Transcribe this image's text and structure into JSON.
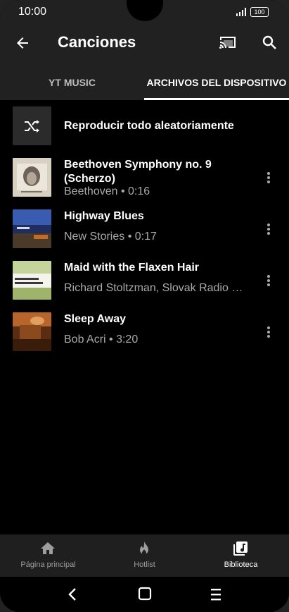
{
  "status_bar": {
    "time": "10:00",
    "battery": "100"
  },
  "app_bar": {
    "title": "Canciones"
  },
  "tabs": [
    {
      "label": "YT MUSIC"
    },
    {
      "label": "ARCHIVOS DEL DISPOSITIVO"
    }
  ],
  "shuffle": {
    "label": "Reproducir todo aleatoriamente"
  },
  "songs": [
    {
      "title": "Beethoven Symphony no. 9 (Scherzo)",
      "subtitle": "Beethoven • 0:16"
    },
    {
      "title": "Highway Blues",
      "subtitle": "New Stories • 0:17"
    },
    {
      "title": "Maid with the Flaxen Hair",
      "subtitle": "Richard Stoltzman, Slovak Radio Sy…"
    },
    {
      "title": "Sleep Away",
      "subtitle": "Bob Acri • 3:20"
    }
  ],
  "bottom_nav": [
    {
      "label": "Página principal",
      "icon": "home-icon"
    },
    {
      "label": "Hotlist",
      "icon": "flame-icon"
    },
    {
      "label": "Biblioteca",
      "icon": "library-icon",
      "active": true
    }
  ]
}
